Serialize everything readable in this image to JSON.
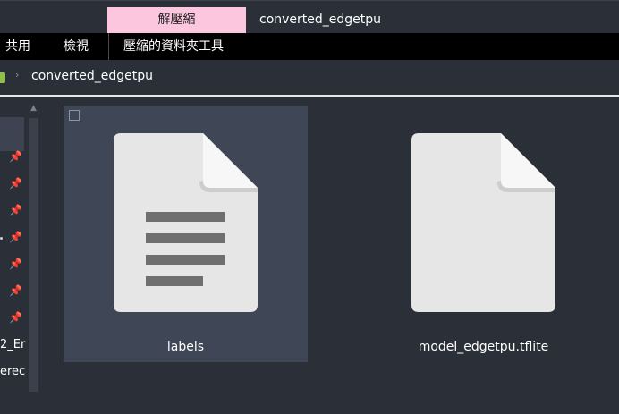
{
  "title_bar": {
    "context_tab_label": "解壓縮",
    "window_title": "converted_edgetpu"
  },
  "ribbon": {
    "tabs": [
      {
        "label": "共用"
      },
      {
        "label": "檢視"
      },
      {
        "label": "壓縮的資料夾工具"
      }
    ]
  },
  "address_bar": {
    "current_folder": "converted_edgetpu",
    "separator": "›"
  },
  "nav_pane": {
    "pin_glyph": "📌",
    "partial_items": [
      {
        "label": "2_Er"
      },
      {
        "label": "erec"
      }
    ]
  },
  "files": [
    {
      "name": "labels",
      "icon": "text-document-icon",
      "selected": true
    },
    {
      "name": "model_edgetpu.tflite",
      "icon": "blank-document-icon",
      "selected": false
    }
  ],
  "colors": {
    "background": "#2b3038",
    "context_tab": "#fbc6de",
    "ribbon": "#000000",
    "selection": "#3f4656",
    "file_icon": "#e6e6e6",
    "text_lines": "#6f6f6f"
  }
}
